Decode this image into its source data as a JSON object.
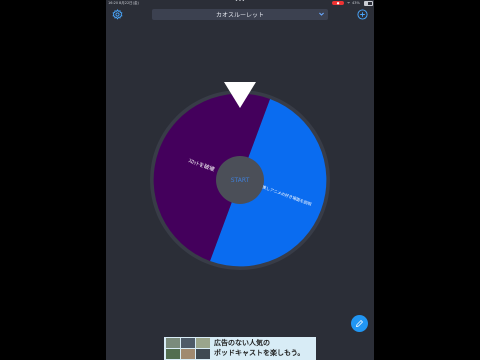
{
  "status_bar": {
    "time": "16:20",
    "date": "8月22日(金)",
    "dots": "•••",
    "recording": "●",
    "wifi": "ᯤ",
    "battery": "43%"
  },
  "header": {
    "title": "カオスルーレット",
    "settings_icon": "gear-icon",
    "add_icon": "plus-circle-icon",
    "dropdown_icon": "chevron-down-icon"
  },
  "roulette": {
    "start_label": "START",
    "segments": [
      {
        "label": "ｽﾛｯﾄを破壊",
        "color": "#44005c"
      },
      {
        "label": "推しアニメの好き場面を説明",
        "color": "#0a6cf0"
      }
    ],
    "pointer_color": "#ffffff",
    "rim_color": "#383c47",
    "center_color": "#4b4f58"
  },
  "edit_button": {
    "icon": "pencil-icon",
    "color": "#2196f3"
  },
  "ad": {
    "line1": "広告のない人気の",
    "line2": "ポッドキャストを楽しもう。"
  }
}
